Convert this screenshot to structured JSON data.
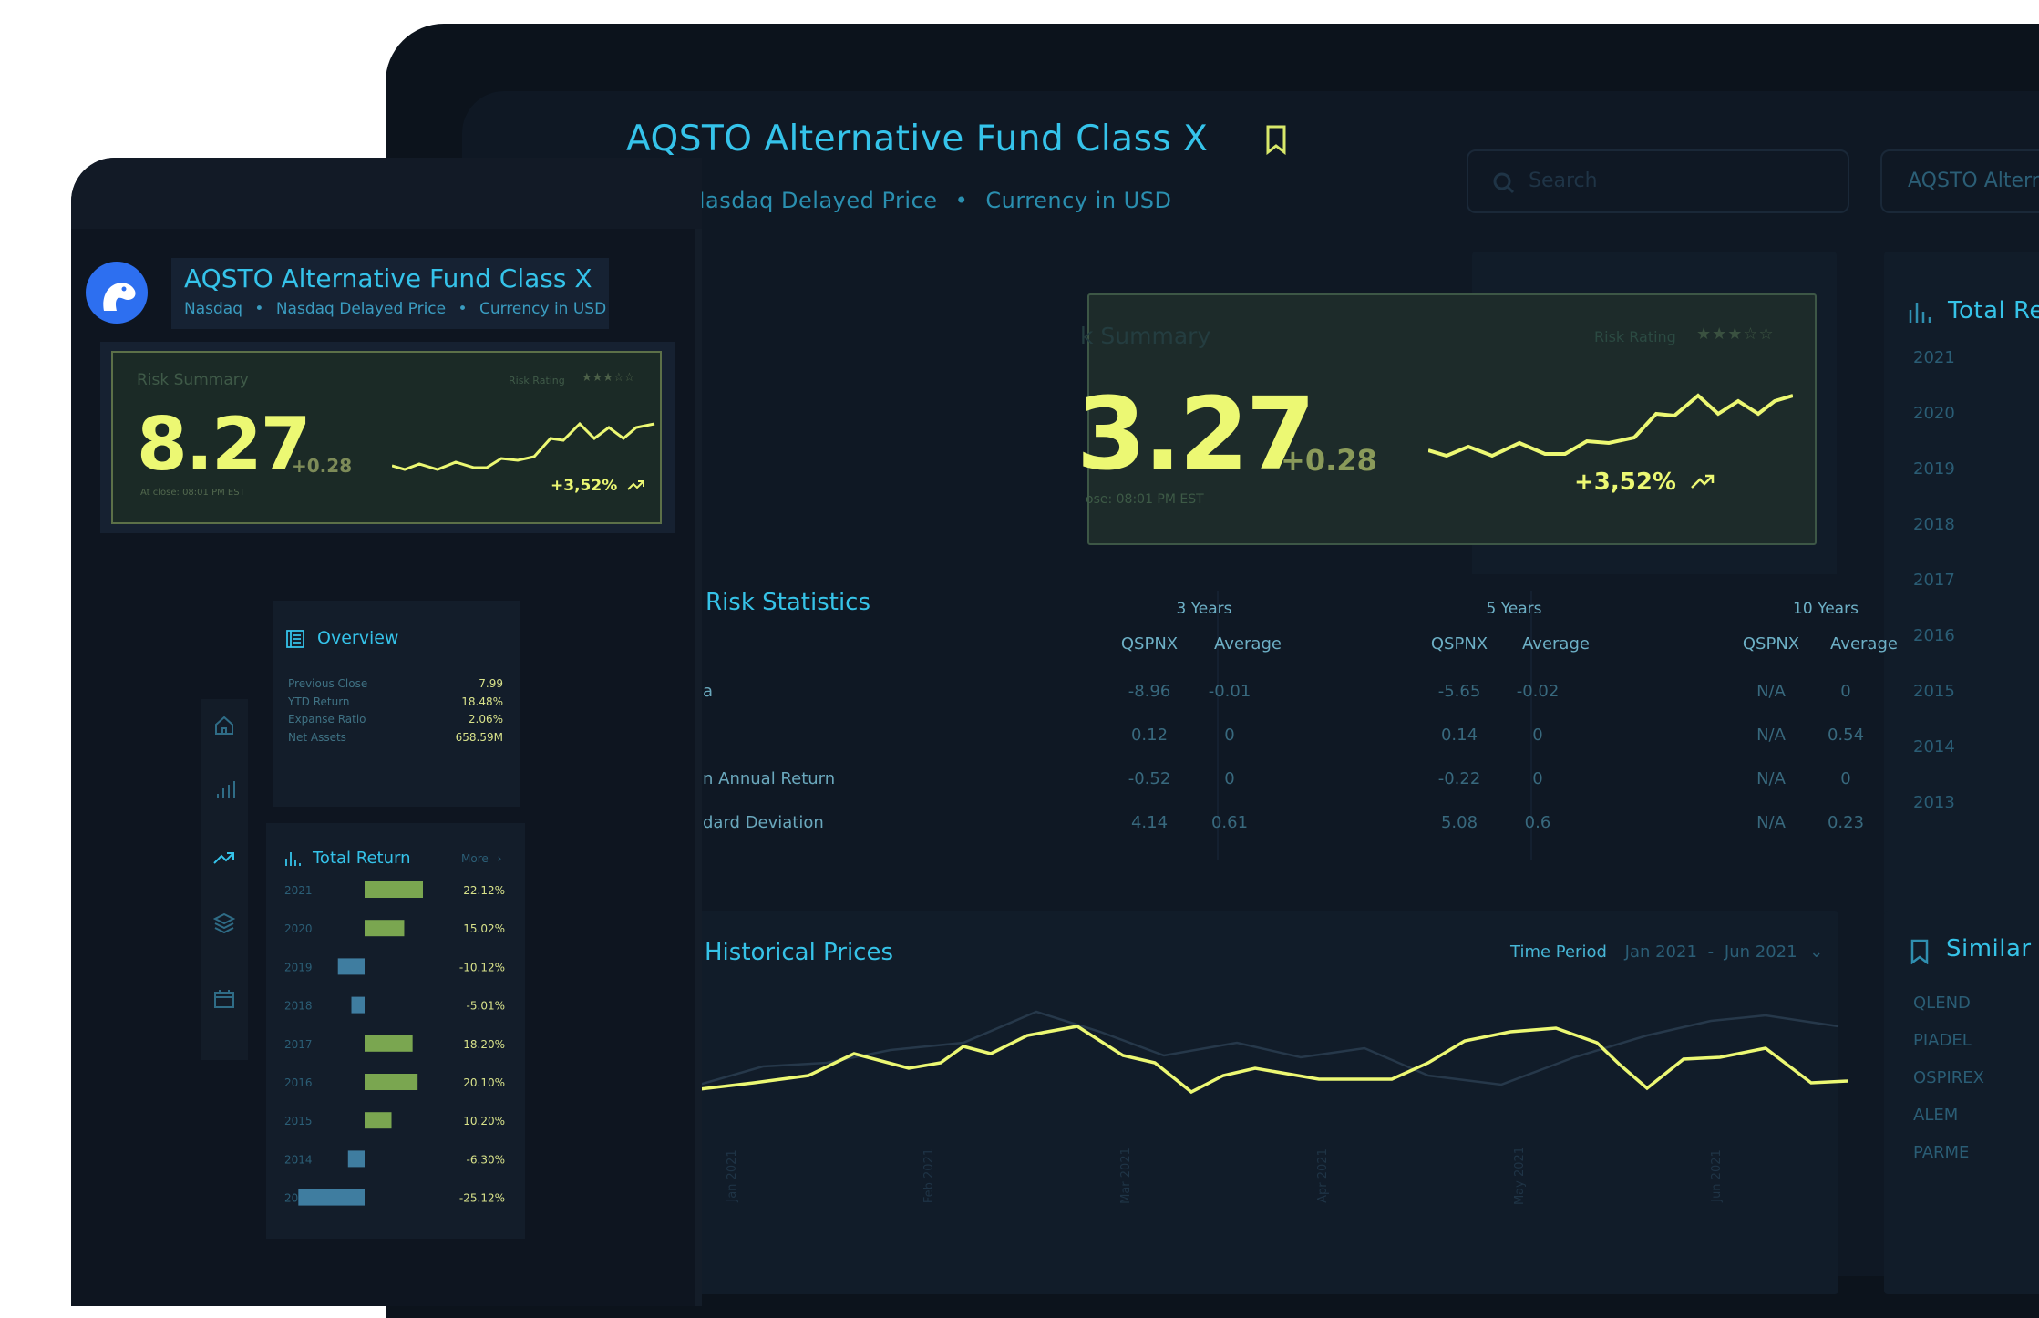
{
  "fund": {
    "title": "AQSTO Alternative Fund Class X",
    "exchange": "Nasdaq",
    "price_type": "Nasdaq Delayed Price",
    "currency": "Currency in USD",
    "exchange_partial": "q",
    "sep": "•"
  },
  "search": {
    "placeholder": "Search"
  },
  "account_button": {
    "label": "AQSTO Altern"
  },
  "risk_summary": {
    "title": "Risk Summary",
    "title_partial": "k Summary",
    "rating_label": "Risk Rating",
    "rating_stars": "★★★☆☆",
    "price": "8.27",
    "price_partial": "3.27",
    "change": "+0.28",
    "close_time": "At close: 08:01 PM EST",
    "close_time_partial": "ose: 08:01 PM EST",
    "pct_change": "+3,52%"
  },
  "overview": {
    "title": "Overview",
    "rows": [
      {
        "label": "Previous Close",
        "value": "7.99"
      },
      {
        "label": "YTD Return",
        "value": "18.48%"
      },
      {
        "label": "Expanse Ratio",
        "value": "2.06%"
      },
      {
        "label": "Net Assets",
        "value": "658.59M"
      }
    ]
  },
  "risk_statistics": {
    "title": "Risk Statistics",
    "periods": [
      "3 Years",
      "5 Years",
      "10 Years"
    ],
    "col_fund": "QSPNX",
    "col_avg": "Average",
    "rows": [
      {
        "label": "a",
        "values": [
          "-8.96",
          "-0.01",
          "-5.65",
          "-0.02",
          "N/A",
          "0"
        ]
      },
      {
        "label": "",
        "values": [
          "0.12",
          "0",
          "0.14",
          "0",
          "N/A",
          "0.54"
        ]
      },
      {
        "label": "n Annual Return",
        "values": [
          "-0.52",
          "0",
          "-0.22",
          "0",
          "N/A",
          "0"
        ]
      },
      {
        "label": "dard Deviation",
        "values": [
          "4.14",
          "0.61",
          "5.08",
          "0.6",
          "N/A",
          "0.23"
        ]
      }
    ]
  },
  "historical": {
    "title": "Historical Prices",
    "period_label": "Time Period",
    "period_from": "Jan 2021",
    "period_dash": "-",
    "period_to": "Jun 2021",
    "chevron": "⌄",
    "x_labels": [
      "Jan 2021",
      "Feb 2021",
      "Mar 2021",
      "Apr 2021",
      "May 2021",
      "Jun 2021"
    ]
  },
  "total_return": {
    "title": "Total Return",
    "title_partial": "Total Re",
    "more": "More",
    "more_chevron": "›",
    "rows": [
      {
        "year": "2021",
        "value": 22.12,
        "label": "22.12%"
      },
      {
        "year": "2020",
        "value": 15.02,
        "label": "15.02%"
      },
      {
        "year": "2019",
        "value": -10.12,
        "label": "-10.12%"
      },
      {
        "year": "2018",
        "value": -5.01,
        "label": "-5.01%"
      },
      {
        "year": "2017",
        "value": 18.2,
        "label": "18.20%"
      },
      {
        "year": "2016",
        "value": 20.1,
        "label": "20.10%"
      },
      {
        "year": "2015",
        "value": 10.2,
        "label": "10.20%"
      },
      {
        "year": "2014",
        "value": -6.3,
        "label": "-6.30%"
      },
      {
        "year": "2013",
        "value": -25.12,
        "label": "-25.12%"
      }
    ]
  },
  "similar": {
    "title": "Similar",
    "items": [
      "QLEND",
      "PIADEL",
      "OSPIREX",
      "ALEM",
      "PARME"
    ]
  },
  "icons": {
    "sidebar": [
      "home-icon",
      "bar-chart-icon",
      "trend-icon",
      "layers-icon",
      "calendar-icon"
    ]
  },
  "colors": {
    "accent": "#35c3ea",
    "highlight": "#ecf873",
    "positive_bar": "#7aa650",
    "negative_bar": "#3f7da0"
  }
}
